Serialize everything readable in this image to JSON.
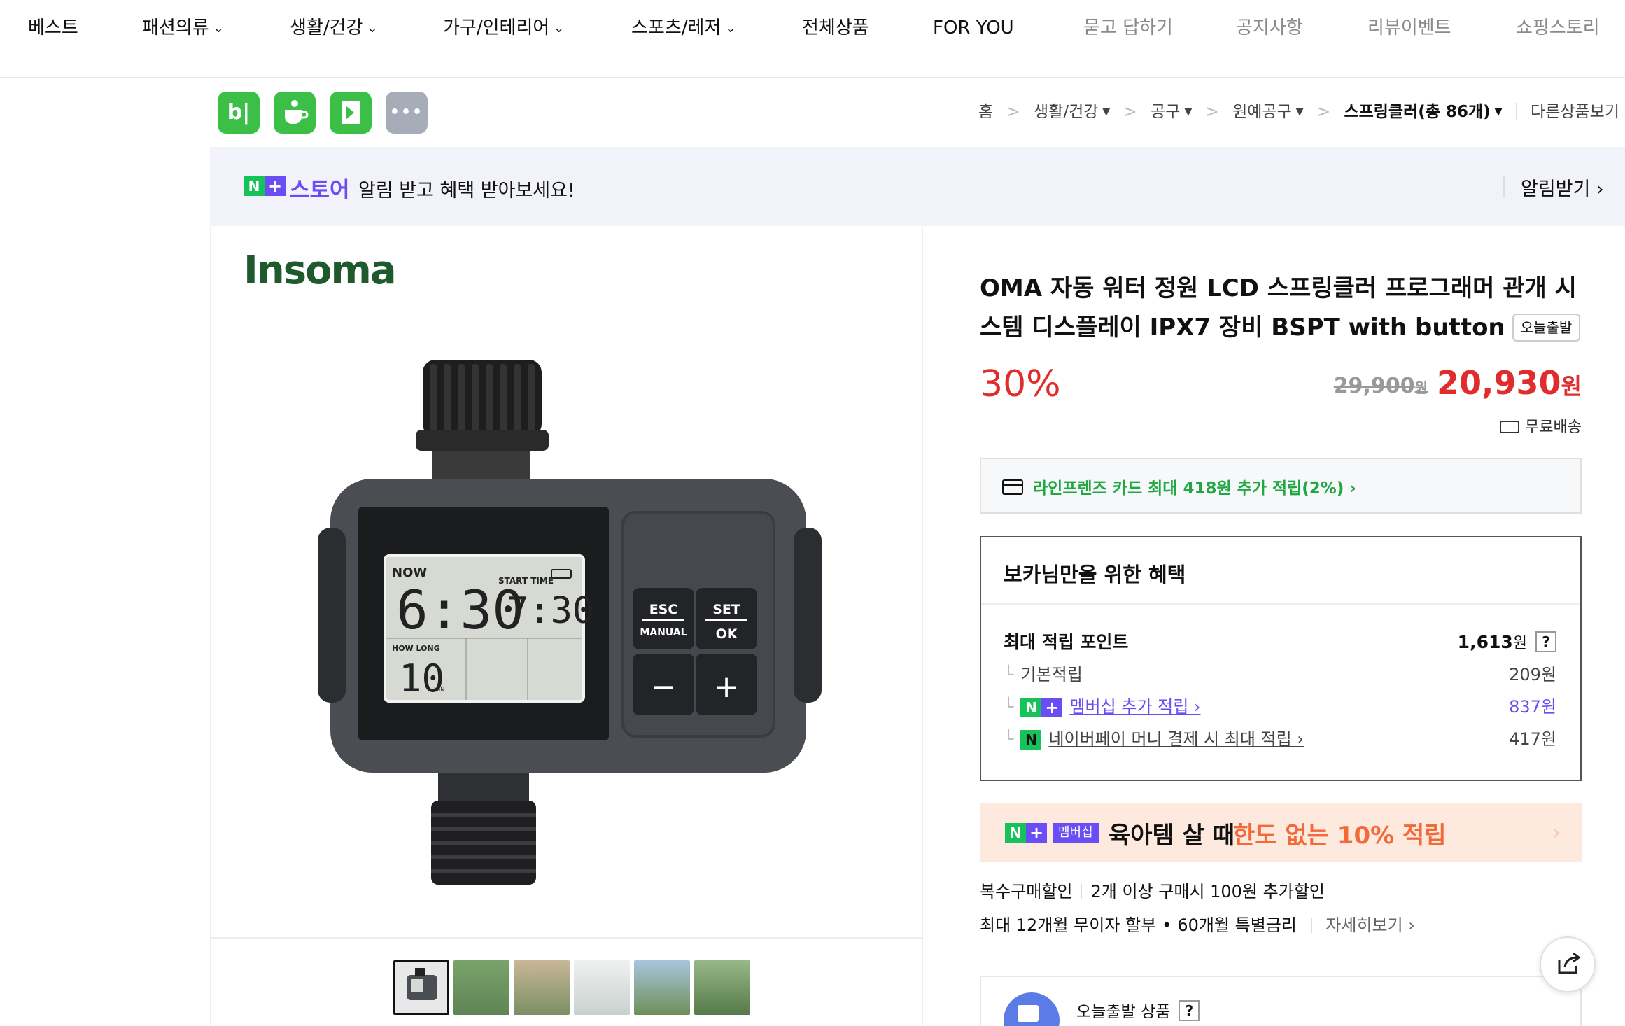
{
  "top_nav": {
    "items": [
      {
        "label": "베스트",
        "dropdown": false
      },
      {
        "label": "패션의류",
        "dropdown": true
      },
      {
        "label": "생활/건강",
        "dropdown": true
      },
      {
        "label": "가구/인테리어",
        "dropdown": true
      },
      {
        "label": "스포츠/레저",
        "dropdown": true
      },
      {
        "label": "전체상품",
        "dropdown": false
      },
      {
        "label": "FOR YOU",
        "dropdown": false
      },
      {
        "label": "묻고 답하기",
        "dropdown": false
      },
      {
        "label": "공지사항",
        "dropdown": false
      },
      {
        "label": "리뷰이벤트",
        "dropdown": false
      },
      {
        "label": "쇼핑스토리",
        "dropdown": false
      }
    ]
  },
  "app_icons": {
    "blog": "b|",
    "more": "•••"
  },
  "breadcrumb": {
    "home": "홈",
    "cat1": "생활/건강",
    "cat2": "공구",
    "cat3": "원예공구",
    "cat4": "스프링클러",
    "cat4_count": "(총 86개)",
    "other": "다른상품보기"
  },
  "alert_banner": {
    "store_word": "스토어",
    "message": "알림 받고 혜택 받아보세요!",
    "cta": "알림받기"
  },
  "gallery": {
    "brand": "Insoma",
    "thumbnail_count": 6
  },
  "product_image": {
    "screen_now": "NOW",
    "screen_time": "6:30",
    "screen_start_label": "START TIME",
    "screen_start_time": "7:30",
    "screen_howlong": "HOW LONG",
    "screen_duration": "10",
    "screen_unit": "MIN",
    "btn_esc": "ESC",
    "btn_manual": "MANUAL",
    "btn_set": "SET",
    "btn_ok": "OK",
    "btn_minus": "−",
    "btn_plus": "+"
  },
  "product": {
    "title": "OMA 자동 워터 정원 LCD 스프링클러 프로그래머 관개 시스템 디스플레이 IPX7 장비 BSPT with button",
    "badge": "오늘출발",
    "discount": "30%",
    "original_price": "29,900",
    "original_unit": "원",
    "sale_price": "20,930",
    "sale_unit": "원",
    "shipping": "무료배송"
  },
  "card_offer": {
    "text": "라인프렌즈 카드 최대 418원 추가 적립(2%) ›"
  },
  "benefits": {
    "heading": "보카님만을 위한 혜택",
    "max_points_label": "최대 적립 포인트",
    "max_points_value": "1,613",
    "max_points_unit": "원",
    "help": "?",
    "rows": [
      {
        "label": "기본적립",
        "value": "209원"
      },
      {
        "label": "멤버십 추가 적립 ›",
        "value": "837원"
      },
      {
        "label": "네이버페이 머니 결제 시 최대 적립 ›",
        "value": "417원"
      }
    ]
  },
  "promo": {
    "member_label": "멤버십",
    "text_a": "육아템 살 때",
    "text_b": "한도 없는 10% 적립",
    "arrow": "›"
  },
  "multi_purchase": {
    "label": "복수구매할인",
    "text": "2개 이상 구매시 100원 추가할인"
  },
  "installment": {
    "text_a": "최대 12개월 무이자 할부",
    "text_b": "60개월 특별금리",
    "detail": "자세히보기 ›"
  },
  "today_ship": {
    "label": "오늘출발 상품",
    "help": "?"
  },
  "colors": {
    "brand_green": "#3cbf46",
    "naver_purple": "#6a4df5",
    "price_red": "#e02c2c",
    "card_green": "#22a843"
  }
}
